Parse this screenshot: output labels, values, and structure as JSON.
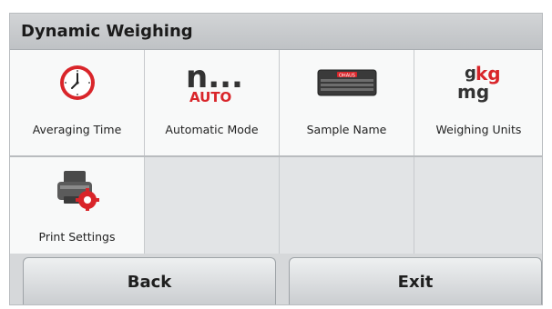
{
  "header": {
    "title": "Dynamic Weighing"
  },
  "tiles": [
    {
      "label": "Averaging Time",
      "icon": "clock-icon"
    },
    {
      "label": "Automatic Mode",
      "icon": "auto-mode-icon",
      "icon_text_top": "n...",
      "icon_text_bottom": "AUTO"
    },
    {
      "label": "Sample Name",
      "icon": "keyboard-icon",
      "icon_text": "OHAUS"
    },
    {
      "label": "Weighing Units",
      "icon": "units-icon",
      "icon_text_g": "g",
      "icon_text_kg": "kg",
      "icon_text_mg": "mg"
    },
    {
      "label": "Print Settings",
      "icon": "printer-gear-icon"
    }
  ],
  "footer": {
    "back_label": "Back",
    "exit_label": "Exit"
  },
  "colors": {
    "accent_red": "#d9252a",
    "background": "#d8dadc"
  }
}
